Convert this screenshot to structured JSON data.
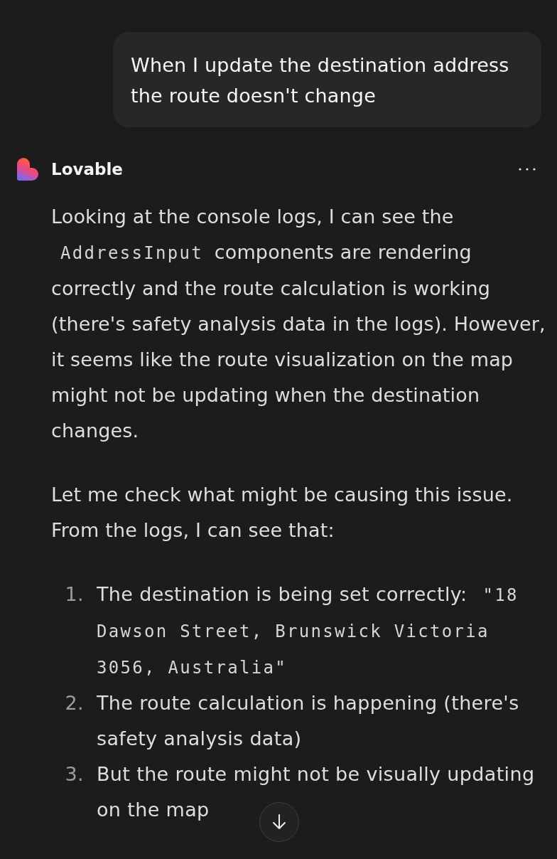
{
  "user_message": {
    "text": "When I update the destination address the route doesn't change"
  },
  "assistant": {
    "name": "Lovable"
  },
  "paragraphs": [
    [
      {
        "kind": "text",
        "text": "Looking at the console logs, I can see the"
      },
      {
        "kind": "code",
        "text": "AddressInput"
      },
      {
        "kind": "text",
        "text": "components are rendering correctly and the route calculation is working (there's safety analysis data in the logs). However, it seems like the route visualization on the map might not be updating when the destination changes."
      }
    ],
    [
      {
        "kind": "text",
        "text": "Let me check what might be causing this issue. From the logs, I can see that:"
      }
    ]
  ],
  "list": [
    {
      "number": "1.",
      "segments": [
        {
          "kind": "text",
          "text": "The destination is being set correctly:"
        },
        {
          "kind": "code",
          "text": "\"18 Dawson Street, Brunswick Victoria 3056, Australia\""
        }
      ]
    },
    {
      "number": "2.",
      "segments": [
        {
          "kind": "text",
          "text": "The route calculation is happening (there's safety analysis data)"
        }
      ]
    },
    {
      "number": "3.",
      "segments": [
        {
          "kind": "text",
          "text": "But the route might not be visually updating on the map"
        }
      ]
    }
  ]
}
